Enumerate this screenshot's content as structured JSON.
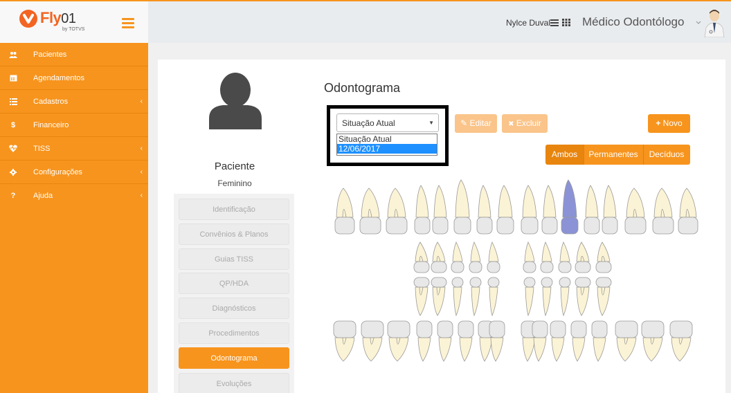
{
  "header": {
    "logo_brand": "Fly",
    "logo_version": "01",
    "logo_subtitle": "by TOTVS",
    "user_name": "Nylce Duval",
    "role": "Médico Odontólogo",
    "icons": [
      "menu-icon",
      "list-icon",
      "grid-icon",
      "chevron-down-icon",
      "doctor-avatar-icon"
    ]
  },
  "sidebar": {
    "items": [
      {
        "label": "Pacientes",
        "icon": "users-icon",
        "glyph": "👥",
        "has_arrow": false
      },
      {
        "label": "Agendamentos",
        "icon": "calendar-icon",
        "glyph": "▦",
        "has_arrow": false
      },
      {
        "label": "Cadastros",
        "icon": "list-icon",
        "glyph": "≡",
        "has_arrow": true
      },
      {
        "label": "Financeiro",
        "icon": "dollar-icon",
        "glyph": "$",
        "has_arrow": false
      },
      {
        "label": "TISS",
        "icon": "heartbeat-icon",
        "glyph": "♥",
        "has_arrow": true
      },
      {
        "label": "Configurações",
        "icon": "gear-icon",
        "glyph": "⚙",
        "has_arrow": true
      },
      {
        "label": "Ajuda",
        "icon": "question-icon",
        "glyph": "?",
        "has_arrow": true
      }
    ],
    "arrow": "‹"
  },
  "patient": {
    "name": "Paciente",
    "gender": "Feminino"
  },
  "patient_menu": {
    "items": [
      "Identificação",
      "Convênios & Planos",
      "Guias TISS",
      "QP/HDA",
      "Diagnósticos",
      "Procedimentos",
      "Odontograma",
      "Evoluções"
    ],
    "active": "Odontograma"
  },
  "odontograma": {
    "title": "Odontograma",
    "select": {
      "value": "Situação Atual",
      "options": [
        "Situação Atual",
        "12/06/2017"
      ],
      "highlighted_option": "12/06/2017"
    },
    "buttons": {
      "editar": "Editar",
      "excluir": "Excluir",
      "novo": "Novo"
    },
    "button_icons": {
      "editar": "✎",
      "excluir": "✖",
      "novo": "+"
    },
    "filters": [
      "Ambos",
      "Permanentes",
      "Decíduos"
    ],
    "active_filter": "Ambos",
    "selected_tooth_color": "#8b93d6"
  },
  "colors": {
    "accent": "#f7941d",
    "sidebar": "#f7941d",
    "dropdown_highlight": "#1e90ff",
    "tooth_fill": "#fbf3d5",
    "tooth_crown": "#e8e8e8"
  }
}
